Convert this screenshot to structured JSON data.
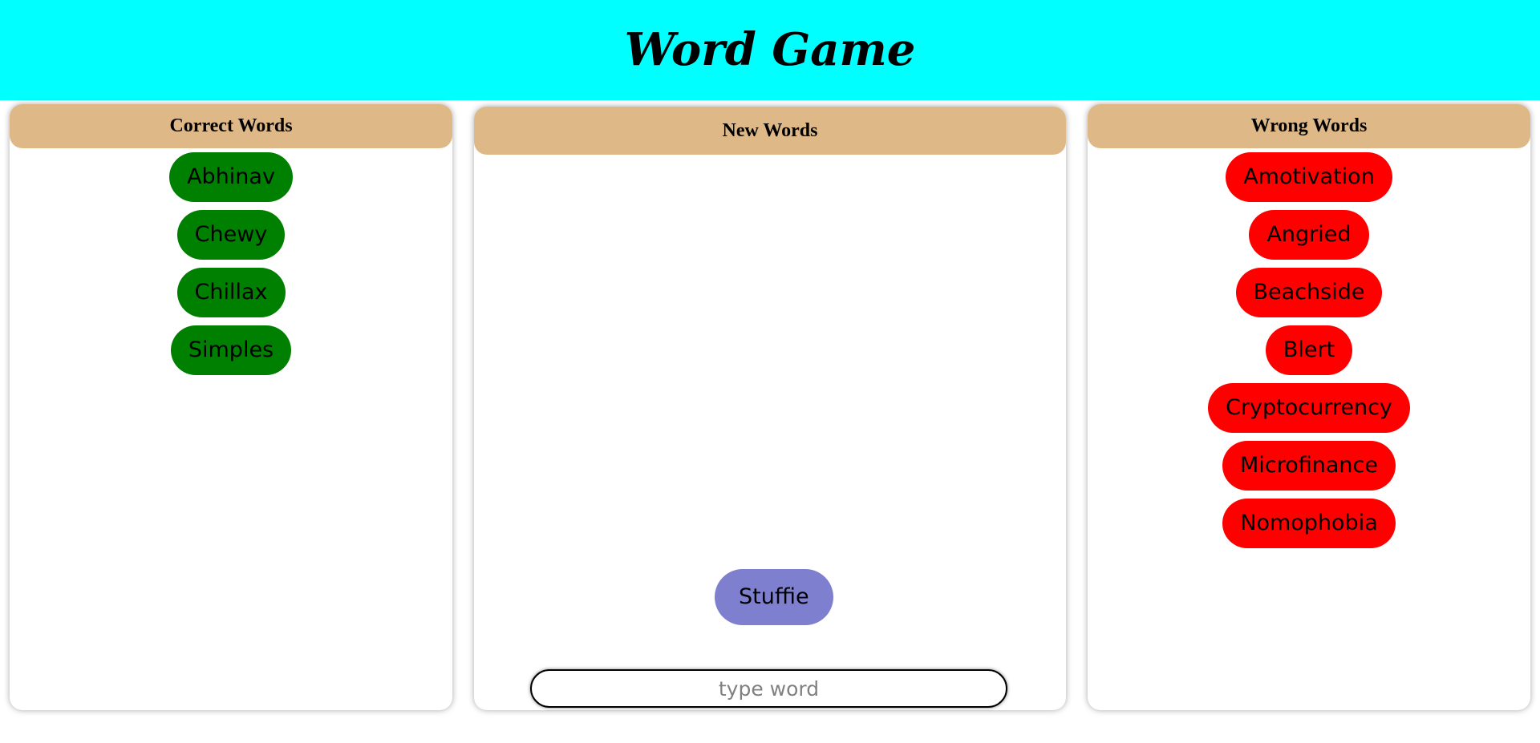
{
  "header": {
    "title": "Word Game",
    "background_color": "#00ffff"
  },
  "correct_panel": {
    "title": "Correct Words",
    "pill_color": "#008000",
    "words": [
      "Abhinav",
      "Chewy",
      "Chillax",
      "Simples"
    ]
  },
  "new_panel": {
    "title": "New Words",
    "current_word": "Stuffie",
    "pill_color": "#7f7fcf",
    "input": {
      "value": "",
      "placeholder": "type word"
    }
  },
  "wrong_panel": {
    "title": "Wrong Words",
    "pill_color": "#ff0000",
    "words": [
      "Amotivation",
      "Angried",
      "Beachside",
      "Blert",
      "Cryptocurrency",
      "Microfinance",
      "Nomophobia"
    ]
  },
  "panel_header_color": "#deb887"
}
